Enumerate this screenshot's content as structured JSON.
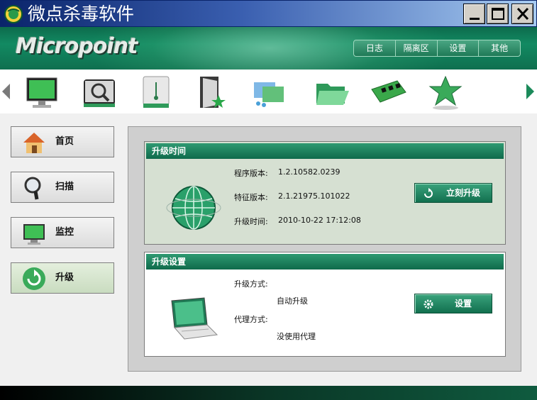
{
  "window": {
    "title": "微点杀毒软件",
    "buttons": [
      "minimize",
      "maximize",
      "close"
    ]
  },
  "header": {
    "logo_text": "Micropoint",
    "menu": [
      "日志",
      "隔离区",
      "设置",
      "其他"
    ]
  },
  "toolbar": {
    "icons": [
      "monitor-icon",
      "magnifier-scan-icon",
      "usb-drive-icon",
      "door-star-icon",
      "folders-icon",
      "open-folder-icon",
      "memory-module-icon",
      "green-star-icon"
    ]
  },
  "nav": [
    {
      "label": "首页",
      "icon": "home-icon",
      "active": false
    },
    {
      "label": "扫描",
      "icon": "magnifier-icon",
      "active": false
    },
    {
      "label": "监控",
      "icon": "monitor-icon",
      "active": false
    },
    {
      "label": "升级",
      "icon": "refresh-icon",
      "active": true
    }
  ],
  "upgrade_time": {
    "title": "升级时间",
    "program_version_label": "程序版本:",
    "program_version": "1.2.10582.0239",
    "signature_version_label": "特征版本:",
    "signature_version": "2.1.21975.101022",
    "upgrade_time_label": "升级时间:",
    "upgrade_time": "2010-10-22 17:12:08",
    "button_label": "立刻升级"
  },
  "upgrade_settings": {
    "title": "升级设置",
    "mode_label": "升级方式:",
    "mode_value": "自动升级",
    "proxy_label": "代理方式:",
    "proxy_value": "没使用代理",
    "button_label": "设置"
  },
  "colors": {
    "accent": "#12704f",
    "title_bar": "#0a246a",
    "panel_bg": "#d6e0d2"
  }
}
